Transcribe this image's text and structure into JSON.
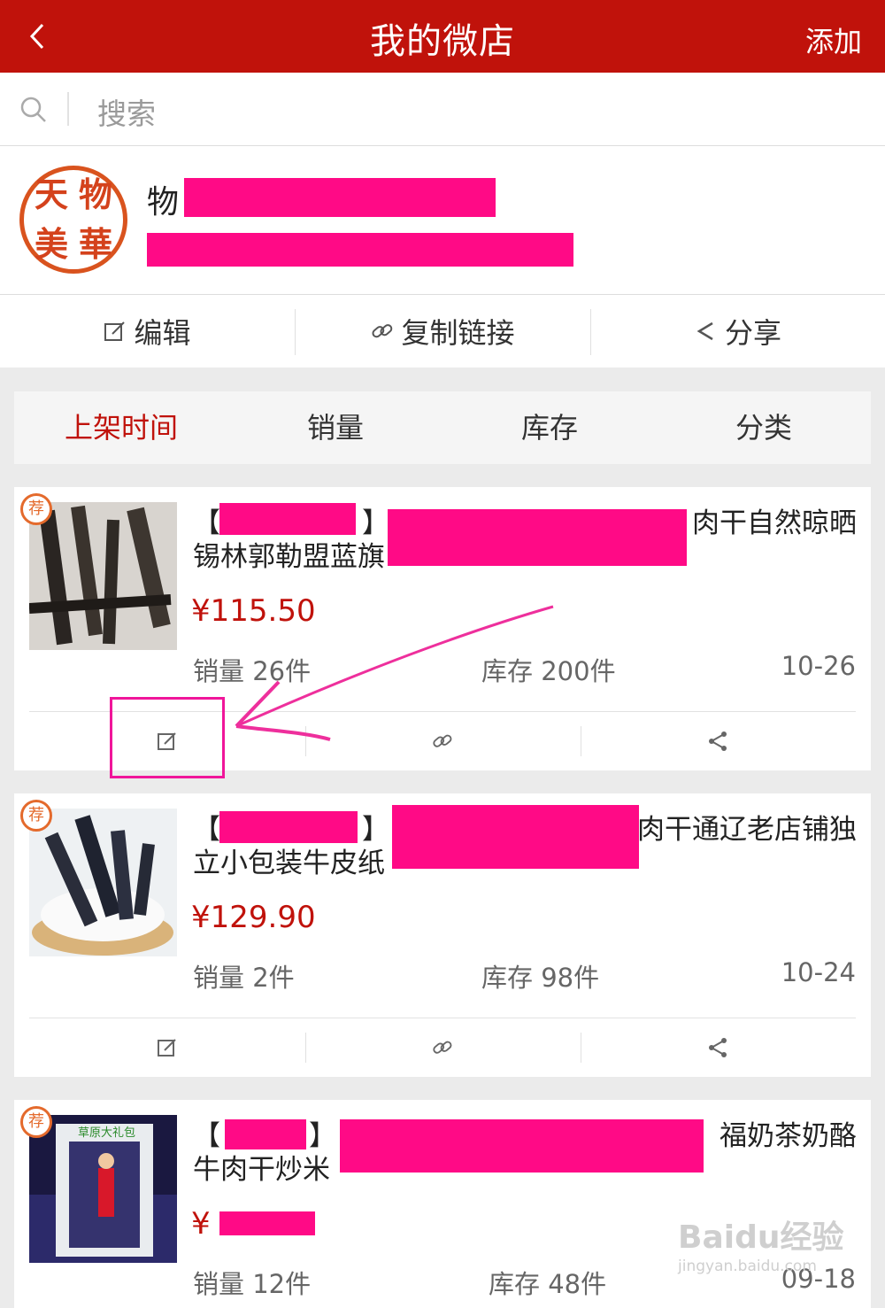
{
  "header": {
    "title": "我的微店",
    "add_label": "添加"
  },
  "search": {
    "placeholder": "搜索"
  },
  "shop": {
    "name_visible": "物"
  },
  "shop_actions": {
    "edit": "编辑",
    "copy_link": "复制链接",
    "share": "分享"
  },
  "sort_tabs": [
    {
      "label": "上架时间",
      "active": true
    },
    {
      "label": "销量",
      "active": false
    },
    {
      "label": "库存",
      "active": false
    },
    {
      "label": "分类",
      "active": false
    }
  ],
  "products": [
    {
      "badge": "荐",
      "title_l1_a": "【",
      "title_l1_b": "】",
      "title_l1_end": "肉干自然晾晒",
      "title_l2": "锡林郭勒盟蓝旗",
      "price": "¥115.50",
      "sales": "销量 26件",
      "stock": "库存 200件",
      "date": "10-26"
    },
    {
      "badge": "荐",
      "title_l1_a": "【",
      "title_l1_b": "】",
      "title_l1_end": "肉干通辽老店铺独",
      "title_l2": "立小包装牛皮纸",
      "price": "¥129.90",
      "sales": "销量 2件",
      "stock": "库存 98件",
      "date": "10-24"
    },
    {
      "badge": "荐",
      "title_l1_a": "【",
      "title_l1_b": "】",
      "title_l1_end": "福奶茶奶酪",
      "title_l2": "牛肉干炒米",
      "price": "¥",
      "sales": "销量 12件",
      "stock": "库存 48件",
      "date": "09-18"
    }
  ],
  "watermark": {
    "brand": "Baidu经验",
    "url": "jingyan.baidu.com"
  },
  "colors": {
    "header_bg": "#c0120b",
    "accent": "#c0120b",
    "redaction": "#ff0a86",
    "highlight": "#f0169a",
    "badge": "#e46a2c"
  },
  "icons": [
    "back-icon",
    "search-icon",
    "edit-icon",
    "link-icon",
    "share-icon"
  ]
}
